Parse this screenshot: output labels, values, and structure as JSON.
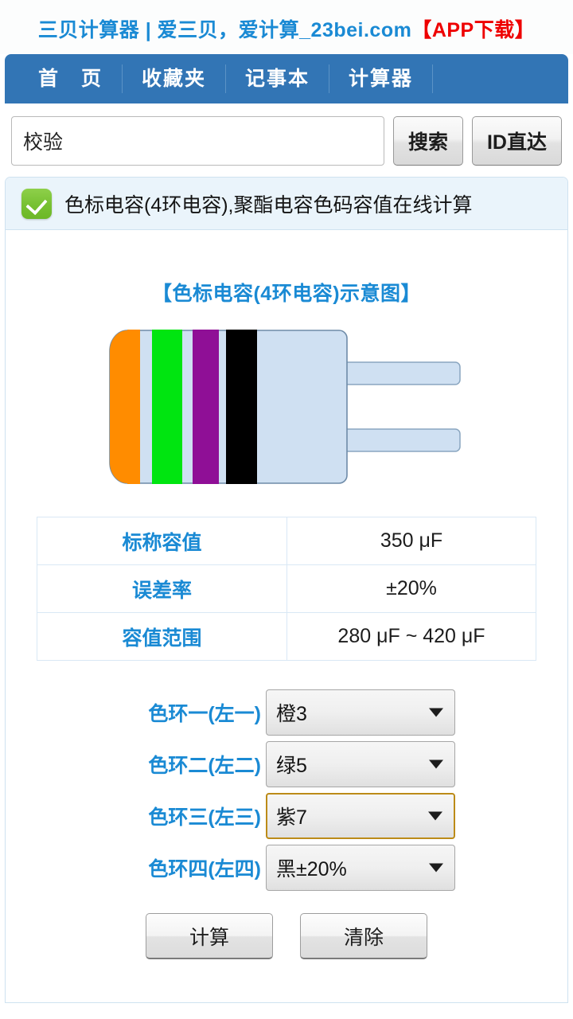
{
  "header": {
    "site_title_main": "三贝计算器 | 爱三贝，爱计算_23bei.com",
    "site_title_app": "【APP下载】"
  },
  "nav": {
    "items": [
      {
        "label": "首　页"
      },
      {
        "label": "收藏夹"
      },
      {
        "label": "记事本"
      },
      {
        "label": "计算器"
      }
    ]
  },
  "search": {
    "value": "校验",
    "placeholder": "",
    "search_button": "搜索",
    "id_button": "ID直达"
  },
  "panel": {
    "header_title": "色标电容(4环电容),聚酯电容色码容值在线计算",
    "check_icon": "check-icon",
    "diagram_title": "【色标电容(4环电容)示意图】"
  },
  "diagram": {
    "body_color": "#cfe0f2",
    "outline_color": "#6e8ba8",
    "bands": [
      {
        "name": "橙",
        "color": "#ff8c00"
      },
      {
        "name": "绿",
        "color": "#00e510"
      },
      {
        "name": "紫",
        "color": "#8f0f96"
      },
      {
        "name": "黑",
        "color": "#000000"
      }
    ]
  },
  "results": {
    "rows": [
      {
        "label": "标称容值",
        "value": "350 μF"
      },
      {
        "label": "误差率",
        "value": "±20%"
      },
      {
        "label": "容值范围",
        "value": "280 μF ~ 420 μF"
      }
    ]
  },
  "bands_form": {
    "rows": [
      {
        "label": "色环一(左一)",
        "value": "橙3",
        "focused": false
      },
      {
        "label": "色环二(左二)",
        "value": "绿5",
        "focused": false
      },
      {
        "label": "色环三(左三)",
        "value": "紫7",
        "focused": true
      },
      {
        "label": "色环四(左四)",
        "value": "黑±20%",
        "focused": false
      }
    ]
  },
  "actions": {
    "calc_label": "计算",
    "clear_label": "清除"
  },
  "colors": {
    "brand_blue": "#1a8ad4",
    "nav_blue": "#3275b5",
    "accent_red": "#ee0000",
    "focus_gold": "#bc8b18",
    "panel_head_bg": "#eaf4fb"
  }
}
